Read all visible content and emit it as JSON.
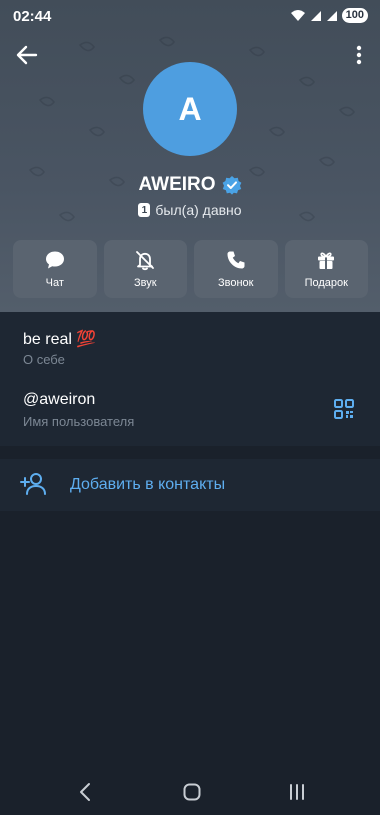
{
  "status_bar": {
    "time": "02:44",
    "battery": "100"
  },
  "profile": {
    "avatar_letter": "A",
    "name": "AWEIRO",
    "last_seen_badge": "1",
    "last_seen": "был(а) давно"
  },
  "actions": [
    {
      "label": "Чат",
      "icon": "chat-icon"
    },
    {
      "label": "Звук",
      "icon": "bell-off-icon"
    },
    {
      "label": "Звонок",
      "icon": "phone-icon"
    },
    {
      "label": "Подарок",
      "icon": "gift-icon"
    }
  ],
  "info": {
    "bio": "be real 💯",
    "bio_caption": "О себе",
    "username": "@aweiron",
    "username_caption": "Имя пользователя"
  },
  "add_contact": {
    "label": "Добавить в контакты"
  },
  "colors": {
    "accent": "#5eaef0",
    "avatar": "#4e9ee0",
    "background": "#1a212b",
    "section": "#1e2733"
  }
}
